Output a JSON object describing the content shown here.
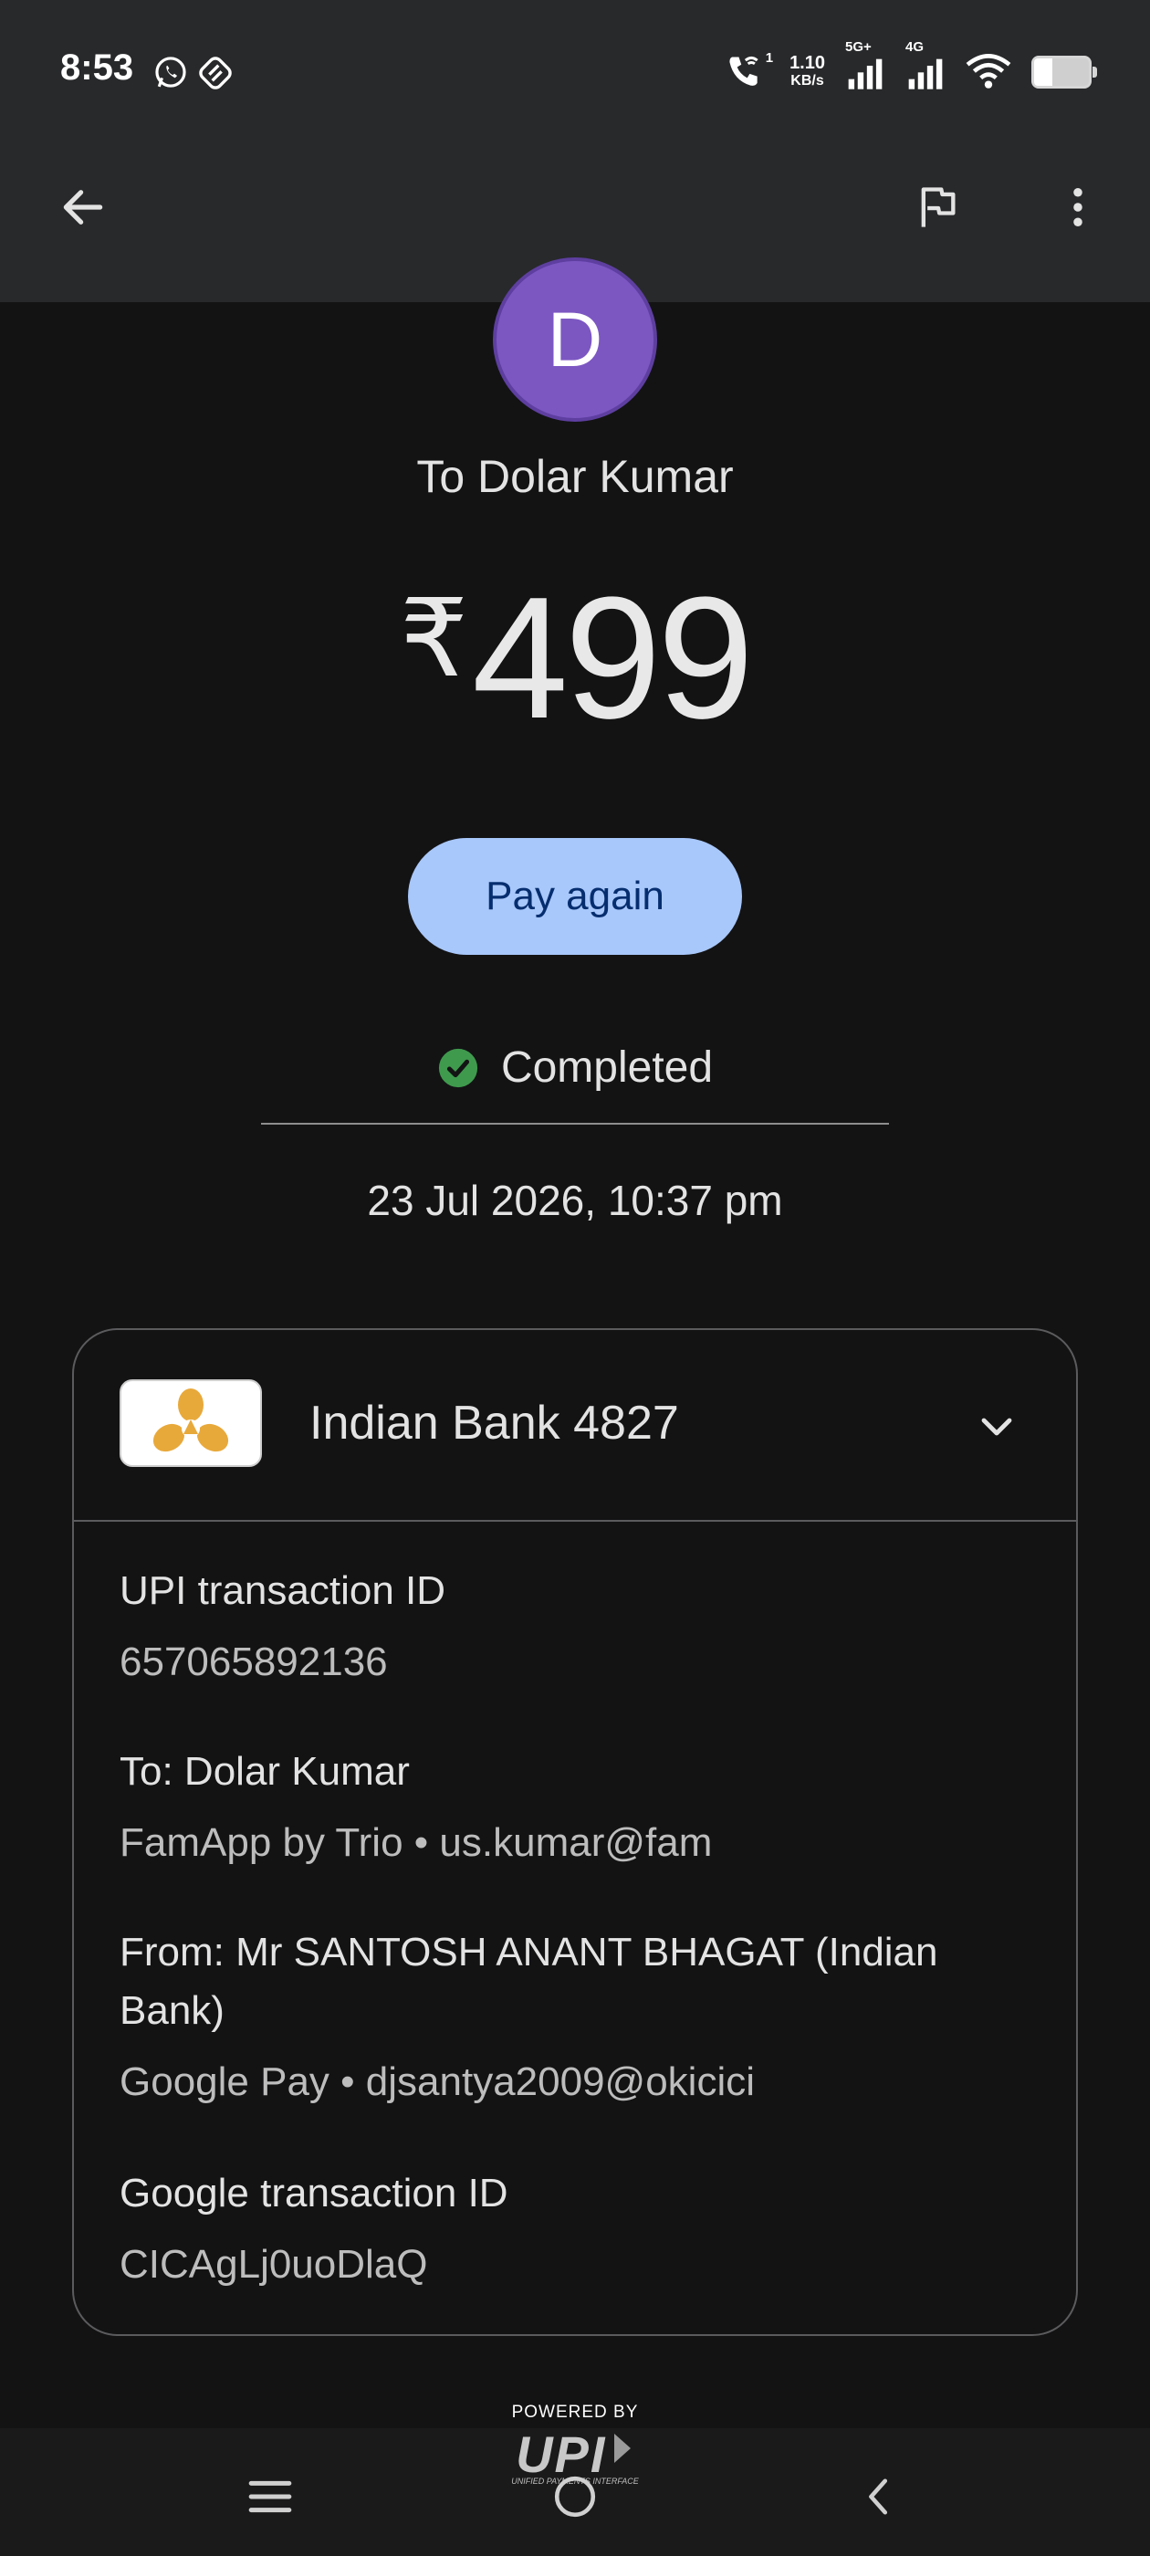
{
  "status_bar": {
    "time": "8:53",
    "net_speed_value": "1.10",
    "net_speed_unit": "KB/s",
    "signal1_label": "5G+",
    "signal2_label": "4G",
    "call_wifi_label": "1",
    "battery_level": 0.34
  },
  "recipient": {
    "avatar_letter": "D",
    "title": "To Dolar Kumar"
  },
  "amount": {
    "currency_symbol": "₹",
    "value": "499"
  },
  "actions": {
    "pay_again_label": "Pay again"
  },
  "status": {
    "text": "Completed",
    "color": "#3f9a4d"
  },
  "datetime": "23 Jul 2026, 10:37 pm",
  "card": {
    "bank_name": "Indian Bank 4827",
    "logo_color": "#e8a93b",
    "details": [
      {
        "label": "UPI transaction ID",
        "value": "657065892136"
      },
      {
        "label": "To: Dolar Kumar",
        "value": "FamApp by Trio • us.kumar@fam"
      },
      {
        "label": "From: Mr SANTOSH ANANT BHAGAT (Indian Bank)",
        "value": "Google Pay • djsantya2009@okicici"
      },
      {
        "label": "Google transaction ID",
        "value": "CICAgLj0uoDlaQ"
      }
    ]
  },
  "footer": {
    "powered_by": "POWERED BY",
    "upi_logo_text": "UPI",
    "upi_subtitle": "UNIFIED PAYMENTS INTERFACE"
  },
  "colors": {
    "accent_button": "#a8c7fa",
    "avatar": "#7c57c2",
    "background": "#131314"
  },
  "icons": {
    "back": "arrow-left-icon",
    "flag": "flag-icon",
    "more": "more-vert-icon",
    "expand": "chevron-down-icon",
    "status": "check-circle-icon"
  }
}
